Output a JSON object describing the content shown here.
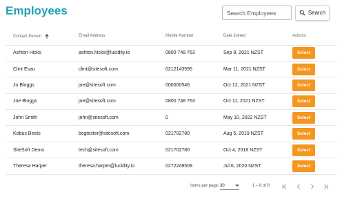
{
  "page": {
    "title": "Employees"
  },
  "search": {
    "placeholder": "Search Employees",
    "value": "",
    "button_label": "Search"
  },
  "table": {
    "headers": [
      "Contact Person",
      "Email Address",
      "Mobile Number",
      "Date Joined",
      "Actions"
    ],
    "sort_column": "Contact Person",
    "sort_direction": "ascending",
    "rows": [
      {
        "name": "Ashton Hicks",
        "email": "ashton.hicks@lucidity.io",
        "mobile": "0800 748 763",
        "joined": "Sep 8, 2021 NZST",
        "action": "Select"
      },
      {
        "name": "Clint Esau",
        "email": "clint@sitesoft.com",
        "mobile": "0212143595",
        "joined": "Mar 11, 2021 NZST",
        "action": "Select"
      },
      {
        "name": "Jo Bloggs",
        "email": "joe@sitesoft.com",
        "mobile": "000000546",
        "joined": "Oct 12, 2021 NZST",
        "action": "Select"
      },
      {
        "name": "Joe Bloggs",
        "email": "joe@sitesoft.com",
        "mobile": "0800 748 763",
        "joined": "Oct 11, 2021 NZST",
        "action": "Select"
      },
      {
        "name": "John Smith",
        "email": "john@sitesoft.com",
        "mobile": "0",
        "joined": "May 10, 2022 NZST",
        "action": "Select"
      },
      {
        "name": "Kobus Beets",
        "email": "bcgtester@sitesoft.com",
        "mobile": "021702780",
        "joined": "Aug 5, 2019 NZST",
        "action": "Select"
      },
      {
        "name": "SiteSoft Demo",
        "email": "tech@sitesoft.com",
        "mobile": "021702780",
        "joined": "Oct 4, 2018 NZST",
        "action": "Select"
      },
      {
        "name": "Theresa Harper",
        "email": "theresa.harper@lucidity.io",
        "mobile": "0272249509",
        "joined": "Jul 6, 2020 NZST",
        "action": "Select"
      }
    ]
  },
  "paginator": {
    "items_per_page_label": "Items per page:",
    "items_per_page": "30",
    "range": "1 – 8 of 8"
  },
  "colors": {
    "title": "#1fa2b2",
    "select_button": "#f5961e"
  },
  "icons": [
    "search-icon",
    "sort-arrow-up-icon",
    "first-page-icon",
    "prev-page-icon",
    "next-page-icon",
    "last-page-icon"
  ]
}
